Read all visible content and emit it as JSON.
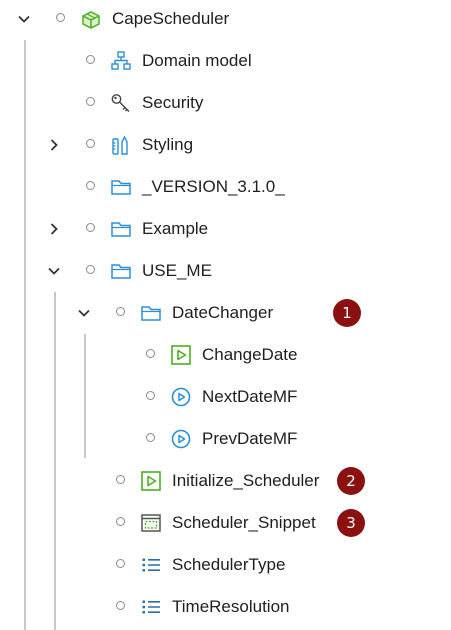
{
  "tree": {
    "root": {
      "label": "CapeScheduler",
      "icon": "module-box-icon"
    },
    "items": [
      {
        "label": "Domain model",
        "icon": "domain-model-icon"
      },
      {
        "label": "Security",
        "icon": "key-icon"
      },
      {
        "label": "Styling",
        "icon": "styling-icon"
      },
      {
        "label": "_VERSION_3.1.0_",
        "icon": "folder-icon"
      },
      {
        "label": "Example",
        "icon": "folder-icon"
      },
      {
        "label": "USE_ME",
        "icon": "folder-icon"
      },
      {
        "label": "DateChanger",
        "icon": "folder-icon",
        "badge": "1"
      },
      {
        "label": "ChangeDate",
        "icon": "microflow-icon"
      },
      {
        "label": "NextDateMF",
        "icon": "nanoflow-icon"
      },
      {
        "label": "PrevDateMF",
        "icon": "nanoflow-icon"
      },
      {
        "label": "Initialize_Scheduler",
        "icon": "microflow-icon",
        "badge": "2"
      },
      {
        "label": "Scheduler_Snippet",
        "icon": "snippet-icon",
        "badge": "3"
      },
      {
        "label": "SchedulerType",
        "icon": "enumeration-icon"
      },
      {
        "label": "TimeResolution",
        "icon": "enumeration-icon"
      }
    ]
  },
  "colors": {
    "badge": "#8b1111",
    "icon_blue": "#2b8fd6",
    "icon_green": "#4cae24",
    "guide": "#c8c8c8"
  }
}
